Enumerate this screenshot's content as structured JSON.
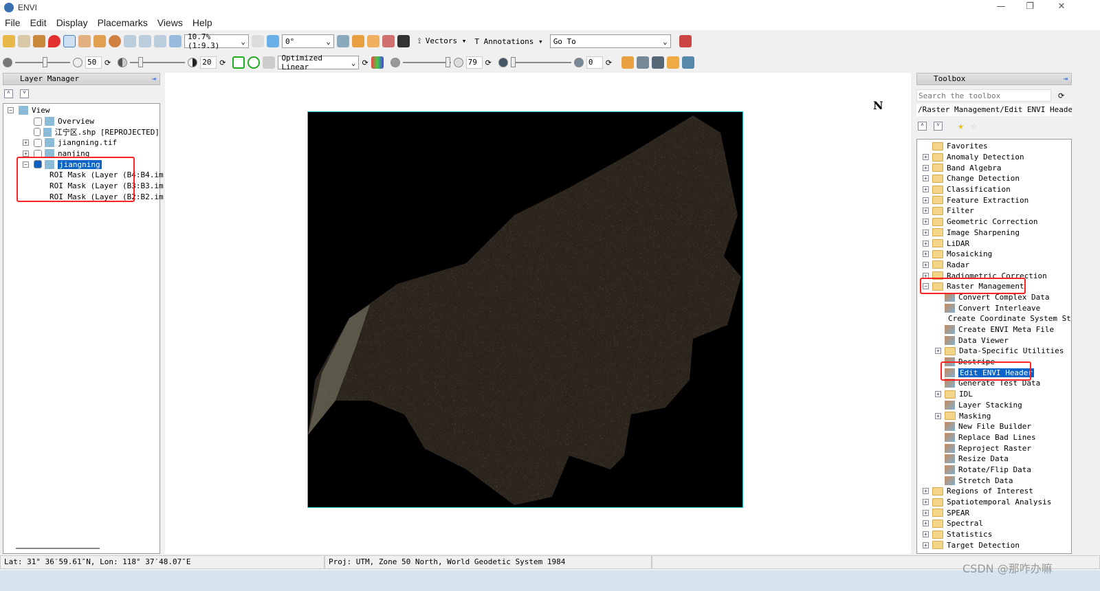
{
  "app": {
    "title": "ENVI"
  },
  "menu": [
    "File",
    "Edit",
    "Display",
    "Placemarks",
    "Views",
    "Help"
  ],
  "toolbar": {
    "zoom_value": "10.7% (1:9.3)",
    "rotation_value": "0°",
    "vectors_label": "Vectors",
    "annotations_label": "Annotations",
    "goto_value": "Go To",
    "brightness": "50",
    "contrast": "20",
    "stretch_value": "Optimized Linear",
    "sharpen": "79",
    "transparency": "0"
  },
  "layer_manager": {
    "title": "Layer Manager",
    "items": [
      {
        "label": "View",
        "level": 0,
        "expander": "−"
      },
      {
        "label": "Overview",
        "level": 1,
        "checked": false
      },
      {
        "label": "江宁区.shp [REPROJECTED]",
        "level": 1,
        "checked": false
      },
      {
        "label": "jiangning.tif",
        "level": 1,
        "checked": false,
        "expander": "+"
      },
      {
        "label": "nanjing",
        "level": 1,
        "checked": false,
        "expander": "+"
      },
      {
        "label": "jiangning",
        "level": 1,
        "checked": true,
        "expander": "−",
        "selected": true
      },
      {
        "label": "ROI Mask (Layer (B4:B4.im",
        "level": 2,
        "color": "#e02020"
      },
      {
        "label": "ROI Mask (Layer (B3:B3.im",
        "level": 2,
        "color": "#20c020"
      },
      {
        "label": "ROI Mask (Layer (B2:B2.im",
        "level": 2,
        "color": "#2030d0"
      }
    ]
  },
  "view": {
    "north_label": "N",
    "frame_color": "#28c8d0"
  },
  "toolbox": {
    "title": "Toolbox",
    "search_placeholder": "Search the toolbox",
    "path": "/Raster Management/Edit ENVI Header",
    "items": [
      {
        "label": "Favorites",
        "level": 0,
        "type": "folder"
      },
      {
        "label": "Anomaly Detection",
        "level": 0,
        "type": "folder",
        "expander": "+"
      },
      {
        "label": "Band Algebra",
        "level": 0,
        "type": "folder",
        "expander": "+"
      },
      {
        "label": "Change Detection",
        "level": 0,
        "type": "folder",
        "expander": "+"
      },
      {
        "label": "Classification",
        "level": 0,
        "type": "folder",
        "expander": "+"
      },
      {
        "label": "Feature Extraction",
        "level": 0,
        "type": "folder",
        "expander": "+"
      },
      {
        "label": "Filter",
        "level": 0,
        "type": "folder",
        "expander": "+"
      },
      {
        "label": "Geometric Correction",
        "level": 0,
        "type": "folder",
        "expander": "+"
      },
      {
        "label": "Image Sharpening",
        "level": 0,
        "type": "folder",
        "expander": "+"
      },
      {
        "label": "LiDAR",
        "level": 0,
        "type": "folder",
        "expander": "+"
      },
      {
        "label": "Mosaicking",
        "level": 0,
        "type": "folder",
        "expander": "+"
      },
      {
        "label": "Radar",
        "level": 0,
        "type": "folder",
        "expander": "+"
      },
      {
        "label": "Radiometric Correction",
        "level": 0,
        "type": "folder",
        "expander": "+"
      },
      {
        "label": "Raster Management",
        "level": 0,
        "type": "folder",
        "expander": "−"
      },
      {
        "label": "Convert Complex Data",
        "level": 1,
        "type": "tool"
      },
      {
        "label": "Convert Interleave",
        "level": 1,
        "type": "tool"
      },
      {
        "label": "Create Coordinate System String",
        "level": 1,
        "type": "tool"
      },
      {
        "label": "Create ENVI Meta File",
        "level": 1,
        "type": "tool"
      },
      {
        "label": "Data Viewer",
        "level": 1,
        "type": "tool"
      },
      {
        "label": "Data-Specific Utilities",
        "level": 1,
        "type": "folder",
        "expander": "+"
      },
      {
        "label": "Destripe",
        "level": 1,
        "type": "tool"
      },
      {
        "label": "Edit ENVI Header",
        "level": 1,
        "type": "tool",
        "selected": true
      },
      {
        "label": "Generate Test Data",
        "level": 1,
        "type": "tool"
      },
      {
        "label": "IDL",
        "level": 1,
        "type": "folder",
        "expander": "+"
      },
      {
        "label": "Layer Stacking",
        "level": 1,
        "type": "tool"
      },
      {
        "label": "Masking",
        "level": 1,
        "type": "folder",
        "expander": "+"
      },
      {
        "label": "New File Builder",
        "level": 1,
        "type": "tool"
      },
      {
        "label": "Replace Bad Lines",
        "level": 1,
        "type": "tool"
      },
      {
        "label": "Reproject Raster",
        "level": 1,
        "type": "tool"
      },
      {
        "label": "Resize Data",
        "level": 1,
        "type": "tool"
      },
      {
        "label": "Rotate/Flip Data",
        "level": 1,
        "type": "tool"
      },
      {
        "label": "Stretch Data",
        "level": 1,
        "type": "tool"
      },
      {
        "label": "Regions of Interest",
        "level": 0,
        "type": "folder",
        "expander": "+"
      },
      {
        "label": "Spatiotemporal Analysis",
        "level": 0,
        "type": "folder",
        "expander": "+"
      },
      {
        "label": "SPEAR",
        "level": 0,
        "type": "folder",
        "expander": "+"
      },
      {
        "label": "Spectral",
        "level": 0,
        "type": "folder",
        "expander": "+"
      },
      {
        "label": "Statistics",
        "level": 0,
        "type": "folder",
        "expander": "+"
      },
      {
        "label": "Target Detection",
        "level": 0,
        "type": "folder",
        "expander": "+"
      }
    ]
  },
  "status": {
    "latlon": "Lat: 31° 36′59.61″N, Lon: 118° 37′48.07″E",
    "projection": "Proj: UTM, Zone 50 North, World Geodetic System 1984"
  },
  "watermark": "CSDN @那咋办嘛"
}
